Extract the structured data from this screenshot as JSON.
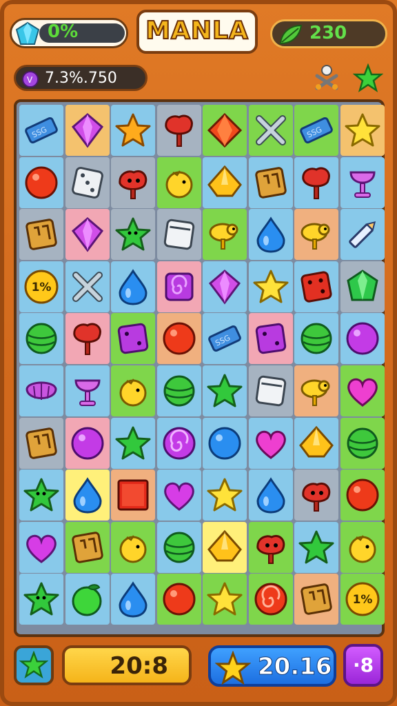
{
  "header": {
    "gem_value": "0%",
    "title": "MANLA",
    "leaf_value": "230",
    "score_value": "7.3%.750"
  },
  "icons": {
    "gem": "blue-gem-icon",
    "leaf": "green-leaf-icon",
    "orb": "purple-orb-icon",
    "tools": "tools-icon",
    "star": "star-icon"
  },
  "footer": {
    "timer_value": "20:8",
    "stars_value": "20.16",
    "moves_value": "·8"
  },
  "cell_colors": {
    "p": "#f2a7b4",
    "o": "#f4c26e",
    "b": "#88c9ea",
    "g": "#7fd64b",
    "y": "#fff07a",
    "v": "#c9a2ea",
    "s": "#a6b3c1",
    "k": "#f0b07f"
  },
  "board": {
    "rows": [
      [
        {
          "c": "b",
          "t": "blue-bar"
        },
        {
          "c": "o",
          "t": "purple-gem"
        },
        {
          "c": "b",
          "t": "orange-star"
        },
        {
          "c": "s",
          "t": "red-tree"
        },
        {
          "c": "g",
          "t": "red-diamond"
        },
        {
          "c": "g",
          "t": "silver-tools"
        },
        {
          "c": "g",
          "t": "blue-bar"
        },
        {
          "c": "o",
          "t": "yellow-star"
        }
      ],
      [
        {
          "c": "b",
          "t": "red-ball"
        },
        {
          "c": "s",
          "t": "white-die"
        },
        {
          "c": "s",
          "t": "red-creature"
        },
        {
          "c": "g",
          "t": "yellow-chick"
        },
        {
          "c": "b",
          "t": "yellow-diamond"
        },
        {
          "c": "b",
          "t": "brown-crate"
        },
        {
          "c": "b",
          "t": "red-tree"
        },
        {
          "c": "b",
          "t": "purple-goblet"
        }
      ],
      [
        {
          "c": "s",
          "t": "brown-crate"
        },
        {
          "c": "p",
          "t": "purple-gem"
        },
        {
          "c": "s",
          "t": "green-star-creature"
        },
        {
          "c": "s",
          "t": "white-box"
        },
        {
          "c": "g",
          "t": "yellow-bird"
        },
        {
          "c": "b",
          "t": "blue-drop"
        },
        {
          "c": "k",
          "t": "yellow-bird"
        },
        {
          "c": "b",
          "t": "pencil"
        }
      ],
      [
        {
          "c": "b",
          "t": "percent-coin",
          "label": "1%"
        },
        {
          "c": "b",
          "t": "silver-tools"
        },
        {
          "c": "b",
          "t": "blue-drop"
        },
        {
          "c": "p",
          "t": "purple-swirl-box"
        },
        {
          "c": "b",
          "t": "purple-gem"
        },
        {
          "c": "b",
          "t": "yellow-star"
        },
        {
          "c": "b",
          "t": "red-die"
        },
        {
          "c": "s",
          "t": "green-gem"
        }
      ],
      [
        {
          "c": "b",
          "t": "green-candy"
        },
        {
          "c": "p",
          "t": "red-tree"
        },
        {
          "c": "g",
          "t": "purple-die"
        },
        {
          "c": "k",
          "t": "red-ball"
        },
        {
          "c": "b",
          "t": "blue-bar"
        },
        {
          "c": "p",
          "t": "purple-die"
        },
        {
          "c": "b",
          "t": "green-candy"
        },
        {
          "c": "b",
          "t": "purple-ball"
        }
      ],
      [
        {
          "c": "b",
          "t": "purple-shell"
        },
        {
          "c": "b",
          "t": "purple-goblet"
        },
        {
          "c": "g",
          "t": "yellow-chick"
        },
        {
          "c": "b",
          "t": "green-candy"
        },
        {
          "c": "b",
          "t": "green-star"
        },
        {
          "c": "s",
          "t": "white-box"
        },
        {
          "c": "k",
          "t": "yellow-bird"
        },
        {
          "c": "g",
          "t": "pink-heart"
        }
      ],
      [
        {
          "c": "s",
          "t": "brown-crate"
        },
        {
          "c": "p",
          "t": "purple-ball"
        },
        {
          "c": "b",
          "t": "green-star"
        },
        {
          "c": "b",
          "t": "purple-swirl"
        },
        {
          "c": "b",
          "t": "blue-ball"
        },
        {
          "c": "b",
          "t": "pink-heart"
        },
        {
          "c": "b",
          "t": "yellow-diamond"
        },
        {
          "c": "g",
          "t": "green-candy"
        }
      ],
      [
        {
          "c": "b",
          "t": "green-star-creature"
        },
        {
          "c": "y",
          "t": "blue-drop"
        },
        {
          "c": "k",
          "t": "red-square"
        },
        {
          "c": "b",
          "t": "purple-heart"
        },
        {
          "c": "b",
          "t": "yellow-star"
        },
        {
          "c": "b",
          "t": "blue-drop"
        },
        {
          "c": "s",
          "t": "red-creature"
        },
        {
          "c": "g",
          "t": "red-ball"
        }
      ],
      [
        {
          "c": "b",
          "t": "purple-heart"
        },
        {
          "c": "g",
          "t": "brown-crate"
        },
        {
          "c": "g",
          "t": "yellow-chick"
        },
        {
          "c": "b",
          "t": "green-candy"
        },
        {
          "c": "y",
          "t": "yellow-diamond"
        },
        {
          "c": "g",
          "t": "red-creature"
        },
        {
          "c": "b",
          "t": "green-star"
        },
        {
          "c": "g",
          "t": "yellow-chick"
        }
      ],
      [
        {
          "c": "b",
          "t": "green-star-creature"
        },
        {
          "c": "b",
          "t": "green-apple"
        },
        {
          "c": "b",
          "t": "blue-drop"
        },
        {
          "c": "g",
          "t": "red-ball"
        },
        {
          "c": "g",
          "t": "yellow-star"
        },
        {
          "c": "g",
          "t": "red-swirl"
        },
        {
          "c": "k",
          "t": "brown-crate"
        },
        {
          "c": "g",
          "t": "percent-coin",
          "label": "1%"
        }
      ]
    ]
  }
}
